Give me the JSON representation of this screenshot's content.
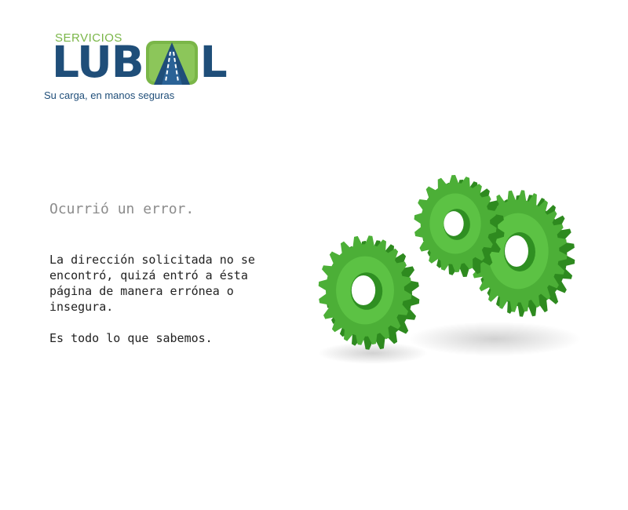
{
  "logo": {
    "top_text": "SERVICIOS",
    "word_left": "LUB",
    "word_right": "L",
    "tagline": "Su carga, en manos seguras"
  },
  "error": {
    "title": "Ocurrió un error.",
    "description": "La dirección solicitada no se encontró, quizá entró a ésta página de manera errónea o insegura.",
    "footer": "Es todo lo que sabemos."
  },
  "colors": {
    "brand_blue": "#1f4e79",
    "brand_green": "#7ab648",
    "gear_green": "#4caf37"
  },
  "illustration": "green-gears-icon"
}
